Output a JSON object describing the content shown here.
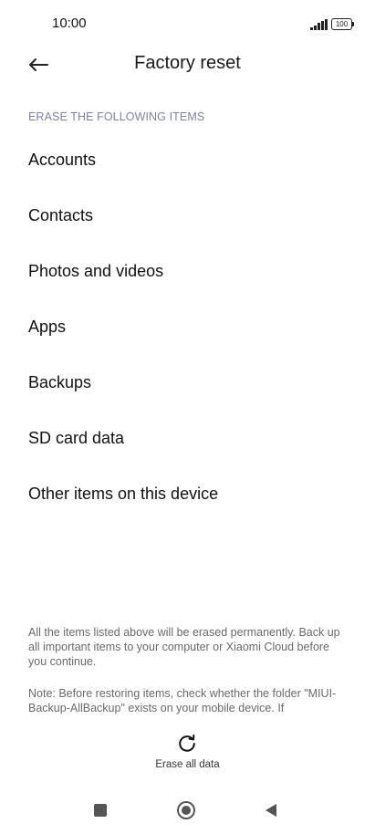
{
  "status_bar": {
    "time": "10:00",
    "battery": "100"
  },
  "header": {
    "title": "Factory reset"
  },
  "section": {
    "title": "ERASE THE FOLLOWING ITEMS",
    "items": [
      {
        "label": "Accounts"
      },
      {
        "label": "Contacts"
      },
      {
        "label": "Photos and videos"
      },
      {
        "label": "Apps"
      },
      {
        "label": "Backups"
      },
      {
        "label": "SD card data"
      },
      {
        "label": "Other items on this device"
      }
    ]
  },
  "notes": {
    "warning": "All the items listed above will be erased permanently. Back up all important items to your computer or Xiaomi Cloud before you continue.",
    "restore": "Note: Before restoring items, check whether the folder \"MIUI-Backup-AllBackup\" exists on your mobile device. If"
  },
  "action": {
    "label": "Erase all data"
  },
  "nav_bar": {
    "icons": [
      "recents-icon",
      "home-icon",
      "back-icon"
    ]
  }
}
